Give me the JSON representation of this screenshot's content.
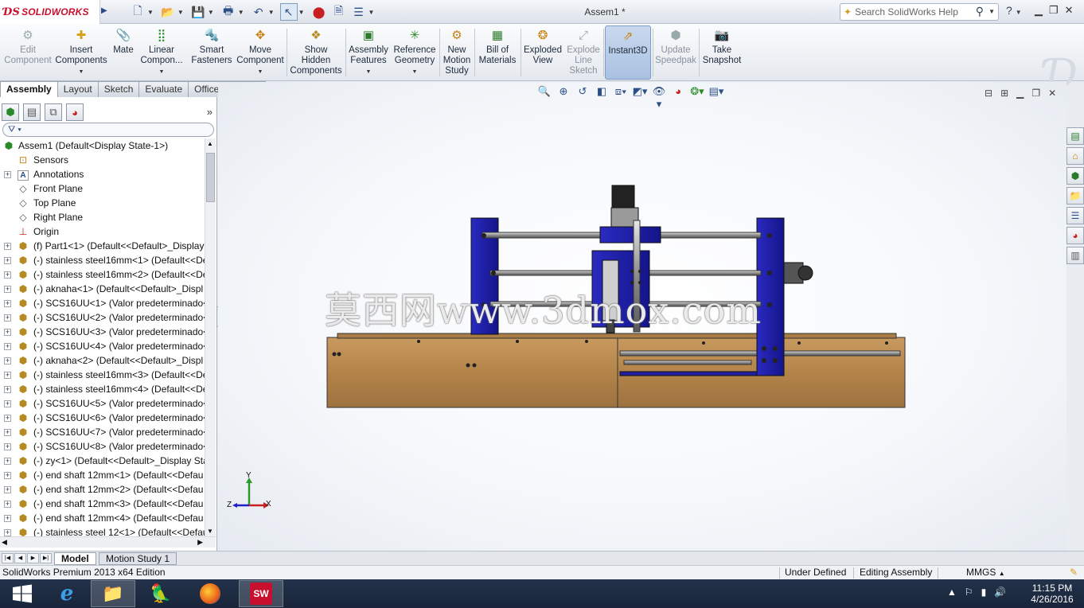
{
  "app": {
    "brand": "SOLIDWORKS",
    "document_title": "Assem1 *",
    "search_placeholder": "Search SolidWorks Help",
    "help_label": "?"
  },
  "ribbon": {
    "buttons": [
      {
        "label1": "Edit",
        "label2": "Component",
        "icon": "edit-component-icon",
        "enabled": false
      },
      {
        "label1": "Insert",
        "label2": "Components",
        "icon": "insert-components-icon",
        "enabled": true
      },
      {
        "label1": "Mate",
        "label2": "",
        "icon": "mate-icon",
        "enabled": true
      },
      {
        "label1": "Linear",
        "label2": "Compon...",
        "icon": "linear-pattern-icon",
        "enabled": true
      },
      {
        "label1": "Smart",
        "label2": "Fasteners",
        "icon": "smart-fasteners-icon",
        "enabled": true
      },
      {
        "label1": "Move",
        "label2": "Component",
        "icon": "move-component-icon",
        "enabled": true
      },
      {
        "label1": "Show",
        "label2": "Hidden",
        "label3": "Components",
        "icon": "show-hidden-icon",
        "enabled": true
      },
      {
        "label1": "Assembly",
        "label2": "Features",
        "icon": "assembly-features-icon",
        "enabled": true
      },
      {
        "label1": "Reference",
        "label2": "Geometry",
        "icon": "reference-geometry-icon",
        "enabled": true
      },
      {
        "label1": "New",
        "label2": "Motion",
        "label3": "Study",
        "icon": "motion-study-icon",
        "enabled": true
      },
      {
        "label1": "Bill of",
        "label2": "Materials",
        "icon": "bom-icon",
        "enabled": true
      },
      {
        "label1": "Exploded",
        "label2": "View",
        "icon": "exploded-view-icon",
        "enabled": true
      },
      {
        "label1": "Explode",
        "label2": "Line",
        "label3": "Sketch",
        "icon": "explode-line-icon",
        "enabled": false
      },
      {
        "label1": "Instant3D",
        "label2": "",
        "icon": "instant3d-icon",
        "enabled": true
      },
      {
        "label1": "Update",
        "label2": "Speedpak",
        "icon": "speedpak-icon",
        "enabled": false
      },
      {
        "label1": "Take",
        "label2": "Snapshot",
        "icon": "snapshot-icon",
        "enabled": true
      }
    ]
  },
  "command_tabs": [
    "Assembly",
    "Layout",
    "Sketch",
    "Evaluate",
    "Office Products"
  ],
  "tree": {
    "root": "Assem1  (Default<Display State-1>)",
    "items": [
      "Sensors",
      "Annotations",
      "Front Plane",
      "Top Plane",
      "Right Plane",
      "Origin",
      "(f) Part1<1> (Default<<Default>_Display",
      "(-) stainless steel16mm<1> (Default<<De",
      "(-) stainless steel16mm<2> (Default<<De",
      "(-) aknaha<1> (Default<<Default>_Displ",
      "(-) SCS16UU<1> (Valor predeterminado<",
      "(-) SCS16UU<2> (Valor predeterminado<",
      "(-) SCS16UU<3> (Valor predeterminado<",
      "(-) SCS16UU<4> (Valor predeterminado<",
      "(-) aknaha<2> (Default<<Default>_Displ",
      "(-) stainless steel16mm<3> (Default<<De",
      "(-) stainless steel16mm<4> (Default<<De",
      "(-) SCS16UU<5> (Valor predeterminado<",
      "(-) SCS16UU<6> (Valor predeterminado<",
      "(-) SCS16UU<7> (Valor predeterminado<",
      "(-) SCS16UU<8> (Valor predeterminado<",
      "(-) zy<1> (Default<<Default>_Display Sta",
      "(-) end shaft 12mm<1> (Default<<Defau",
      "(-) end shaft 12mm<2> (Default<<Defau",
      "(-) end shaft 12mm<3> (Default<<Defau",
      "(-) end shaft 12mm<4> (Default<<Defau",
      "(-) stainless steel 12<1> (Default<<Defau"
    ]
  },
  "viewport": {
    "watermark": "莫西网www.3dmox.com",
    "triad": {
      "x": "X",
      "y": "Y",
      "z": "Z"
    }
  },
  "bottom_tabs": [
    "Model",
    "Motion Study 1"
  ],
  "status": {
    "edition": "SolidWorks Premium 2013 x64 Edition",
    "defined": "Under Defined",
    "mode": "Editing Assembly",
    "units": "MMGS"
  },
  "taskbar": {
    "time": "11:15 PM",
    "date": "4/26/2016"
  },
  "colors": {
    "frame_blue": "#1a1aa8",
    "wood": "#b98a52",
    "accent": "#c8102e"
  }
}
